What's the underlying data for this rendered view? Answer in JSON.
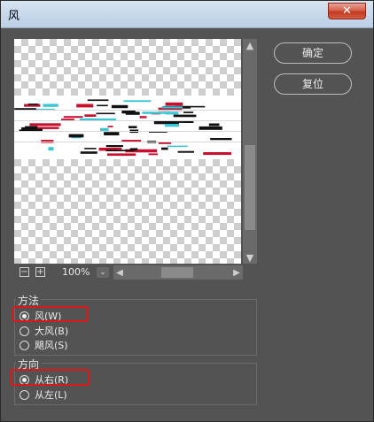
{
  "window": {
    "title": "风"
  },
  "buttons": {
    "ok": "确定",
    "reset": "复位",
    "close_glyph": "✕"
  },
  "zoom": {
    "value": "100%",
    "minus": "−",
    "plus": "+",
    "dropdown": "⌄"
  },
  "scroll": {
    "up": "▲",
    "down": "▼",
    "left": "◀",
    "right": "▶"
  },
  "method": {
    "legend": "方法",
    "options": [
      {
        "label": "风(W)",
        "checked": true
      },
      {
        "label": "大风(B)",
        "checked": false
      },
      {
        "label": "飓风(S)",
        "checked": false
      }
    ]
  },
  "direction": {
    "legend": "方向",
    "options": [
      {
        "label": "从右(R)",
        "checked": true
      },
      {
        "label": "从左(L)",
        "checked": false
      }
    ]
  },
  "colors": {
    "highlight": "#e01515",
    "panel": "#535353",
    "wind_stroke_red": "#c8102e",
    "wind_stroke_cyan": "#39c6d6"
  }
}
